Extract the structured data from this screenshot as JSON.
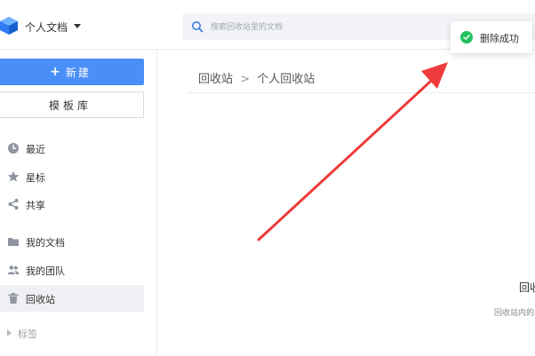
{
  "header": {
    "workspace_title": "个人文档",
    "search_placeholder": "搜索回收站里的文档"
  },
  "toast": {
    "message": "删除成功",
    "color": "#22c05d"
  },
  "sidebar": {
    "new_button": "新建",
    "template_button": "模板库",
    "items": [
      {
        "label": "最近",
        "icon": "clock-icon"
      },
      {
        "label": "星标",
        "icon": "star-icon"
      },
      {
        "label": "共享",
        "icon": "share-icon"
      },
      {
        "label": "我的文档",
        "icon": "folder-icon"
      },
      {
        "label": "我的团队",
        "icon": "team-icon"
      },
      {
        "label": "回收站",
        "icon": "trash-icon",
        "active": true
      }
    ],
    "tags_label": "标签"
  },
  "main": {
    "breadcrumb": [
      "回收站",
      "个人回收站"
    ],
    "breadcrumb_separator": ">",
    "empty_title": "回收站",
    "empty_subtitle": "回收站内的"
  },
  "colors": {
    "accent": "#4a8ef7",
    "annotation_arrow": "#ee3b3b"
  }
}
